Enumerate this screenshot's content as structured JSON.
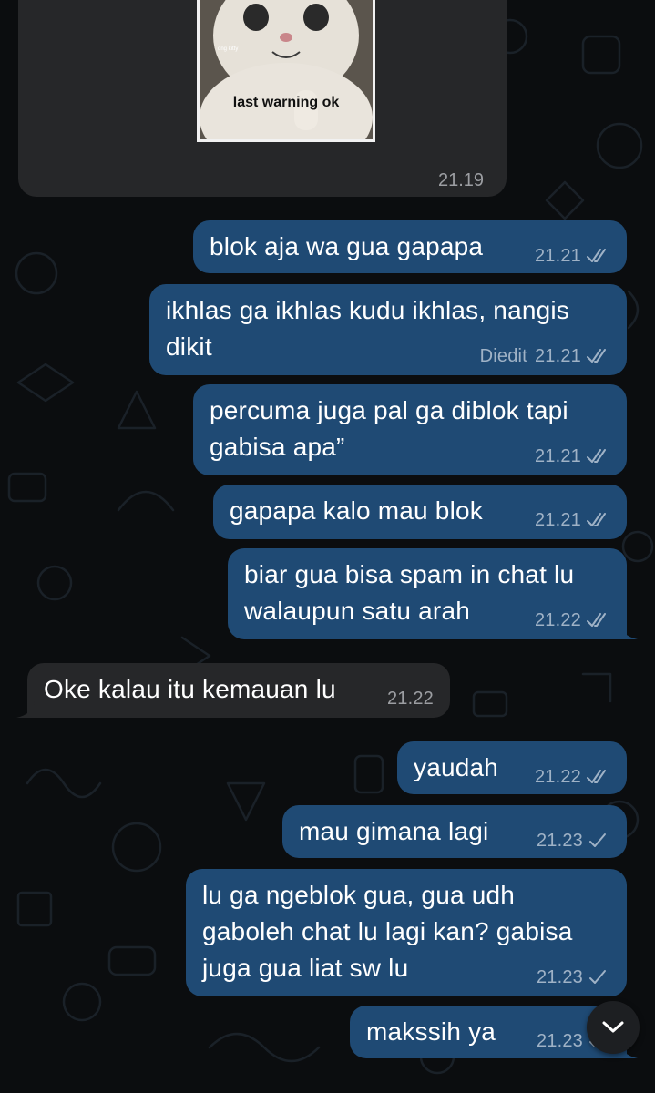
{
  "sticker_message": {
    "sticker_caption": "last warning ok",
    "sticker_watermark": "dng kitty",
    "time": "21.19"
  },
  "messages": [
    {
      "direction": "out",
      "text": "blok aja wa gua gapapa",
      "time": "21.21",
      "status": "read"
    },
    {
      "direction": "out",
      "text": "ikhlas ga ikhlas kudu ikhlas, nangis\ndikit",
      "edited_label": "Diedit",
      "time": "21.21",
      "status": "read"
    },
    {
      "direction": "out",
      "text": "percuma juga pal ga diblok tapi\ngabisa apa”",
      "time": "21.21",
      "status": "read"
    },
    {
      "direction": "out",
      "text": "gapapa kalo mau blok",
      "time": "21.21",
      "status": "read"
    },
    {
      "direction": "out",
      "text": "biar gua bisa spam in chat lu\nwalaupun satu arah",
      "time": "21.22",
      "status": "read"
    },
    {
      "direction": "in",
      "text": "Oke kalau itu kemauan lu",
      "time": "21.22"
    },
    {
      "direction": "out",
      "text": "yaudah",
      "time": "21.22",
      "status": "read"
    },
    {
      "direction": "out",
      "text": "mau gimana lagi",
      "time": "21.23",
      "status": "sent"
    },
    {
      "direction": "out",
      "text": "lu ga ngeblok gua, gua udh\ngaboleh chat lu lagi kan? gabisa\njuga gua liat sw lu",
      "time": "21.23",
      "status": "sent"
    },
    {
      "direction": "out",
      "text": "makssih ya",
      "time": "21.23",
      "status": "sent"
    }
  ],
  "icons": {
    "read_receipt": "double-check-icon",
    "sent_receipt": "single-check-icon",
    "scroll_down": "chevron-down-icon"
  },
  "colors": {
    "background": "#0b0d0f",
    "outgoing_bubble": "#1f4a74",
    "incoming_bubble": "#262729",
    "meta_outgoing": "#9fb2c6",
    "meta_incoming": "#9c9ea2"
  }
}
